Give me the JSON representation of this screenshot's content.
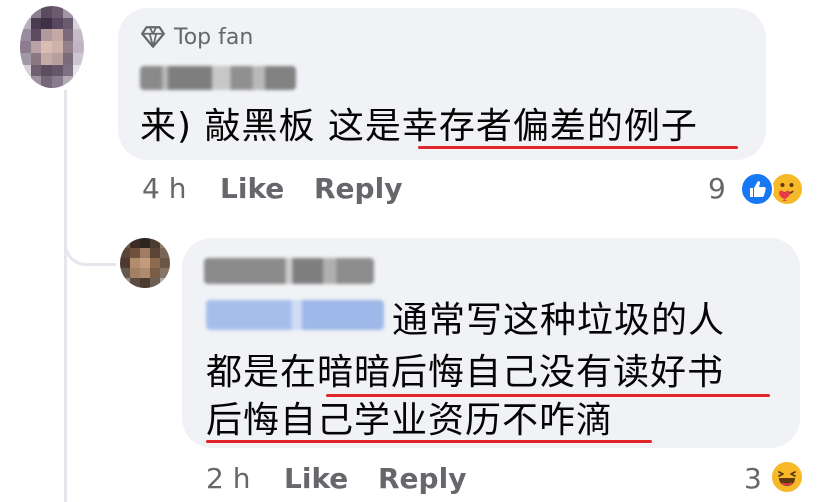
{
  "comment": {
    "badge": "Top fan",
    "author": "Kenny Lim",
    "text": "来) 敲黑板 这是幸存者偏差的例子",
    "time": "4 h",
    "like_label": "Like",
    "reply_label": "Reply",
    "reaction_count": "9",
    "reactions": [
      "like-icon",
      "care-icon"
    ]
  },
  "reply": {
    "author": "Pewee Ting",
    "mention": "Kenny Lim",
    "line1": "通常写这种垃圾的人",
    "line2": "都是在暗暗后悔自己没有读好书",
    "line3": "后悔自己学业资历不咋滴",
    "time": "2 h",
    "like_label": "Like",
    "reply_label": "Reply",
    "reaction_count": "3",
    "reactions": [
      "haha-icon"
    ]
  },
  "colors": {
    "bubble": "#f0f2f5",
    "meta_text": "#65676b",
    "underline": "#e0262b",
    "like_blue": "#1877f2",
    "thread_line": "#e4e6eb"
  }
}
